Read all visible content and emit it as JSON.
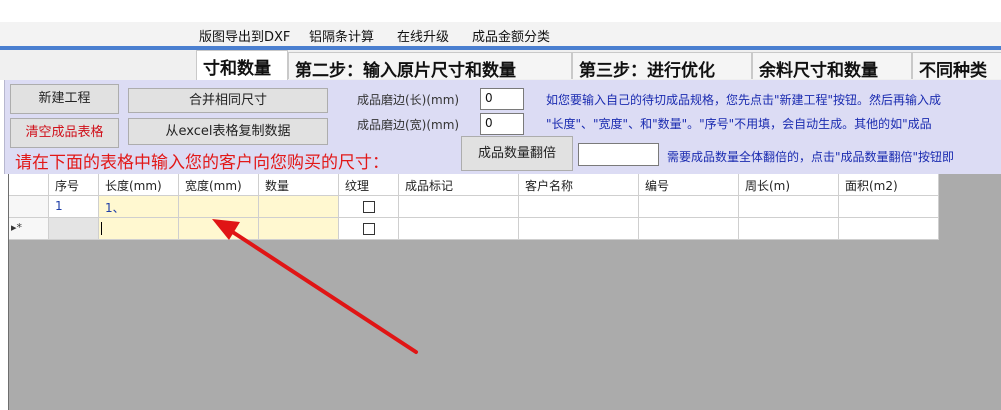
{
  "menu": {
    "items": [
      "版图导出到DXF",
      "铝隔条计算",
      "在线升级",
      "成品金额分类"
    ]
  },
  "tabs": [
    {
      "label": "寸和数量",
      "active": true
    },
    {
      "label": "第二步：输入原片尺寸和数量",
      "active": false
    },
    {
      "label": "第三步：进行优化",
      "active": false
    },
    {
      "label": "余料尺寸和数量",
      "active": false
    },
    {
      "label": "不同种类",
      "active": false
    }
  ],
  "buttons": {
    "new_project": "新建工程",
    "merge_same": "合并相同尺寸",
    "clear_table": "清空成品表格",
    "copy_excel": "从excel表格复制数据",
    "qty_multiply": "成品数量翻倍"
  },
  "edge": {
    "length_label": "成品磨边(长)(mm)",
    "length_value": "0",
    "width_label": "成品磨边(宽)(mm)",
    "width_value": "0"
  },
  "info": {
    "line1": "如您要输入自己的待切成品规格，您先点击\"新建工程\"按钮。然后再输入成",
    "line2": "\"长度\"、\"宽度\"、和\"数量\"。\"序号\"不用填，会自动生成。其他的如\"成品",
    "line3": "需要成品数量全体翻倍的，点击\"成品数量翻倍\"按钮即"
  },
  "multiply_input": "",
  "prompt": "请在下面的表格中输入您的客户向您购买的尺寸：",
  "table": {
    "columns": [
      "序号",
      "长度(mm)",
      "宽度(mm)",
      "数量",
      "纹理",
      "成品标记",
      "客户名称",
      "编号",
      "周长(m)",
      "面积(m2)"
    ],
    "rows": [
      {
        "index": "1",
        "length": "1、",
        "width": "",
        "qty": "",
        "texture_checked": false,
        "mark": "",
        "customer": "",
        "code": "",
        "perimeter": "",
        "area": ""
      }
    ],
    "new_row_marker": "▸*"
  },
  "colors": {
    "accent_blue": "#4a7fd0",
    "panel_bg": "#dcdcf4",
    "prompt_red": "#e21818",
    "info_blue": "#1a2bb0",
    "arrow_red": "#e01515",
    "input_yellow": "#fff8d0"
  }
}
